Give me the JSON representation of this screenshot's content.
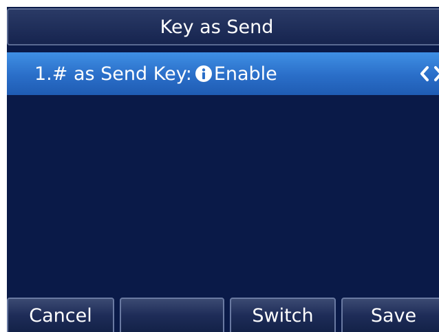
{
  "header": {
    "title": "Key as Send"
  },
  "setting": {
    "label": "1.# as Send Key:",
    "value": "Enable",
    "info_icon": "info-icon",
    "arrow_icons": [
      "chevron-left-icon",
      "chevron-right-icon"
    ]
  },
  "softkeys": [
    {
      "label": "Cancel"
    },
    {
      "label": ""
    },
    {
      "label": "Switch"
    },
    {
      "label": "Save"
    }
  ],
  "colors": {
    "background": "#0a1a48",
    "selected_row": "#2a6ec8",
    "text": "#ffffff"
  }
}
